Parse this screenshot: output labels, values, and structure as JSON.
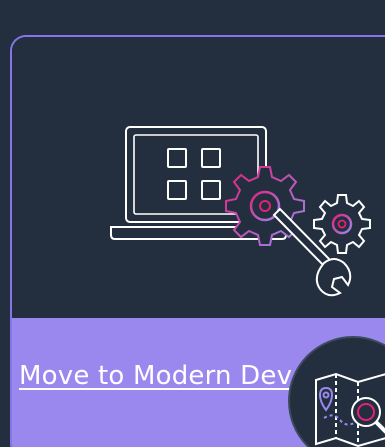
{
  "card": {
    "title": "Move to Modern Dev",
    "illustration_icon": "laptop-with-gears-and-wrench-icon",
    "badge_icon": "map-search-icon"
  },
  "colors": {
    "page_background": "#232f3e",
    "card_border": "#8575e8",
    "footer_background": "#9a88ef",
    "title_text": "#ffffff",
    "icon_stroke": "#ffffff",
    "icon_accent_pink": "#e2217a",
    "icon_accent_purple": "#9a88ef"
  }
}
